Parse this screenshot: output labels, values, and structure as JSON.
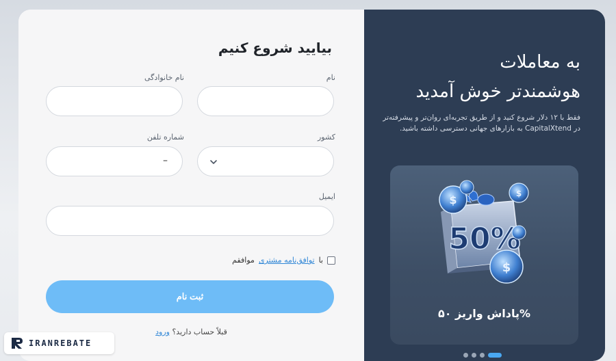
{
  "form": {
    "title": "بیایید شروع کنیم",
    "first_name_label": "نام",
    "last_name_label": "نام خانوادگی",
    "country_label": "کشور",
    "phone_label": "شماره تلفن",
    "phone_value": "–",
    "email_label": "ایمیل",
    "agree_prefix": "با",
    "agree_link": "توافق‌نامه مشتری",
    "agree_suffix": "موافقم",
    "submit_label": "ثبت نام",
    "login_question": "قبلاً حساب دارید؟",
    "login_link": "ورود"
  },
  "promo": {
    "title_line1": "به معاملات",
    "title_line2": "هوشمندتر خوش آمدید",
    "description": "فقط با ۱۲ دلار شروع کنید و از طریق تجربه‌ای روان‌تر و پیشرفته‌تر در CapitalXtend به بازارهای جهانی دسترسی داشته باشید.",
    "bonus_graphic_text": "50%",
    "bonus_label": "%پاداش واریز ۵۰",
    "slides": 4,
    "active_slide": 1
  },
  "watermark": {
    "text": "IRANREBATE"
  },
  "colors": {
    "promo_bg": "#2d3d54",
    "submit_bg": "#6ebcf7",
    "link": "#2f86d6",
    "dot_active": "#4aa8f2"
  }
}
